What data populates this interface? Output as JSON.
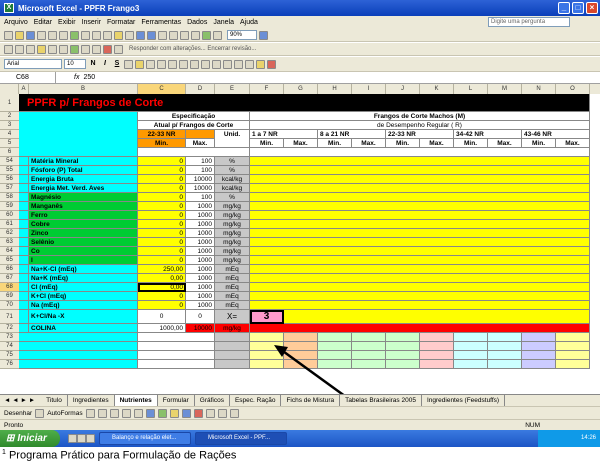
{
  "window": {
    "title": "Microsoft Excel - PPFR Frango3"
  },
  "menu": [
    "Arquivo",
    "Editar",
    "Exibir",
    "Inserir",
    "Formatar",
    "Ferramentas",
    "Dados",
    "Janela",
    "Ajuda"
  ],
  "help_placeholder": "Digite uma pergunta",
  "toolbar2_text": "Responder com alterações...   Encerrar revisão...",
  "zoom": "90%",
  "font": {
    "name": "Arial",
    "size": "10"
  },
  "formula": {
    "cell_ref": "C68",
    "fx": "fx",
    "value": "250"
  },
  "columns": [
    "A",
    "B",
    "C",
    "D",
    "E",
    "F",
    "G",
    "H",
    "I",
    "J",
    "K",
    "L",
    "M",
    "N",
    "O"
  ],
  "sheet": {
    "title": "PPFR  p/ Frangos de Corte",
    "spec_header": "Especificação",
    "spec_sub": "Atual p/ Frangos de Corte",
    "age_range": "22-33  NR",
    "col_min": "Min.",
    "col_max": "Max.",
    "col_unit": "Unid.",
    "right_title": "Frangos de Corte Machos (M)",
    "right_sub": "de Desempenho Regular ( R)",
    "ranges": [
      "1 a 7  NR",
      "8 a 21  NR",
      "22-33  NR",
      "34-42  NR",
      "43-46  NR"
    ],
    "rows": [
      {
        "n": "54",
        "label": "Matéria Mineral",
        "min": "0",
        "max": "100",
        "unit": "%"
      },
      {
        "n": "55",
        "label": "Fósforo (P) Total",
        "min": "0",
        "max": "100",
        "unit": "%"
      },
      {
        "n": "56",
        "label": "Energia Bruta",
        "min": "0",
        "max": "10000",
        "unit": "kcal/kg"
      },
      {
        "n": "57",
        "label": "Energia Met. Verd. Aves",
        "min": "0",
        "max": "10000",
        "unit": "kcal/kg"
      },
      {
        "n": "58",
        "label": "Magnésio",
        "min": "0",
        "max": "100",
        "unit": "%"
      },
      {
        "n": "59",
        "label": "Manganês",
        "min": "0",
        "max": "1000",
        "unit": "mg/kg"
      },
      {
        "n": "60",
        "label": "Ferro",
        "min": "0",
        "max": "1000",
        "unit": "mg/kg"
      },
      {
        "n": "61",
        "label": "Cobre",
        "min": "0",
        "max": "1000",
        "unit": "mg/kg"
      },
      {
        "n": "62",
        "label": "Zinco",
        "min": "0",
        "max": "1000",
        "unit": "mg/kg"
      },
      {
        "n": "63",
        "label": "Selênio",
        "min": "0",
        "max": "1000",
        "unit": "mg/kg"
      },
      {
        "n": "64",
        "label": "Co",
        "min": "0",
        "max": "1000",
        "unit": "mg/kg"
      },
      {
        "n": "65",
        "label": "I",
        "min": "0",
        "max": "1000",
        "unit": "mg/kg"
      },
      {
        "n": "66",
        "label": "Na+K-Cl (mEq)",
        "min": "250,00",
        "max": "1000",
        "unit": "mEq"
      },
      {
        "n": "67",
        "label": "Na+K (mEq)",
        "min": "0,00",
        "max": "1000",
        "unit": "mEq"
      },
      {
        "n": "68",
        "label": "Cl (mEq)",
        "min": "0,00",
        "max": "1000",
        "unit": "mEq"
      },
      {
        "n": "69",
        "label": "K+Cl (mEq)",
        "min": "0",
        "max": "1000",
        "unit": "mEq"
      },
      {
        "n": "70",
        "label": "Na (mEq)",
        "min": "0",
        "max": "1000",
        "unit": "mEq"
      }
    ],
    "row71": {
      "n": "71",
      "label": "K+Cl/Na -X",
      "min": "0",
      "max": "0",
      "xeq": "X=",
      "xval": "3"
    },
    "row72": {
      "n": "72",
      "label": "COLINA",
      "min": "1000,00",
      "max": "10000",
      "unit": "mg/kg"
    },
    "empty_rows": [
      "73",
      "74",
      "75",
      "76"
    ]
  },
  "tabs": [
    "Titulo",
    "Ingredientes",
    "Nutrientes",
    "Formular",
    "Gráficos",
    "Espec. Ração",
    "Fichs de Mistura",
    "Tabelas Brasileiras 2005",
    "Ingredientes (Feedstuffs)"
  ],
  "active_tab": "Nutrientes",
  "drawbar": {
    "draw": "Desenhar",
    "autoshapes": "AutoFormas"
  },
  "status": {
    "left": "Pronto",
    "right": "NUM"
  },
  "taskbar": {
    "start": "Iniciar",
    "tasks": [
      "Balanço e relação elet...",
      "Microsoft Excel - PPF..."
    ],
    "clock": "14:26"
  },
  "caption": {
    "sup": "1",
    "text": "Programa Prático para Formulação de Rações"
  },
  "colors": {
    "title_bg": "#000000",
    "title_fg": "#ff0000",
    "yellow": "#ffff00",
    "green": "#00cc33",
    "cyan": "#00ffff",
    "orange": "#ff9900",
    "red": "#ff0000"
  }
}
